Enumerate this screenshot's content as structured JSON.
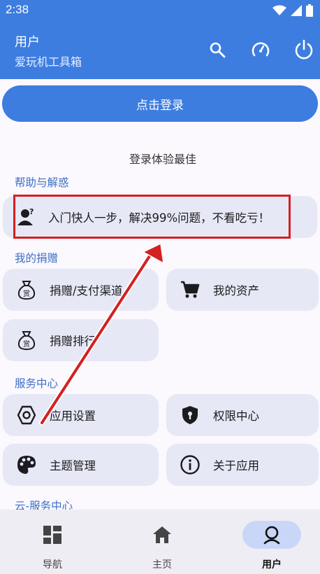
{
  "status": {
    "time": "2:38"
  },
  "header": {
    "title": "用户",
    "subtitle": "爱玩机工具箱"
  },
  "login": {
    "button_label": "点击登录",
    "hint": "登录体验最佳"
  },
  "sections": {
    "help": {
      "title": "帮助与解惑",
      "items": [
        {
          "label": "入门快人一步，解决99%问题，不看吃亏！",
          "icon": "user-question-icon"
        }
      ]
    },
    "donate": {
      "title": "我的捐赠",
      "items": [
        {
          "label": "捐赠/支付渠道",
          "icon": "money-bag-icon"
        },
        {
          "label": "我的资产",
          "icon": "cart-icon"
        },
        {
          "label": "捐赠排行",
          "icon": "money-bag-icon"
        }
      ]
    },
    "service": {
      "title": "服务中心",
      "items": [
        {
          "label": "应用设置",
          "icon": "settings-hexagon-icon"
        },
        {
          "label": "权限中心",
          "icon": "shield-lock-icon"
        },
        {
          "label": "主题管理",
          "icon": "palette-icon"
        },
        {
          "label": "关于应用",
          "icon": "info-icon"
        }
      ]
    },
    "cloud": {
      "title": "云-服务中心"
    }
  },
  "nav": [
    {
      "label": "导航",
      "icon": "dashboard-icon"
    },
    {
      "label": "主页",
      "icon": "home-icon"
    },
    {
      "label": "用户",
      "icon": "user-icon"
    }
  ],
  "colors": {
    "primary": "#3d7de0",
    "card": "#e6e8f5",
    "highlight": "#d42020",
    "section": "#3d6fc4"
  }
}
